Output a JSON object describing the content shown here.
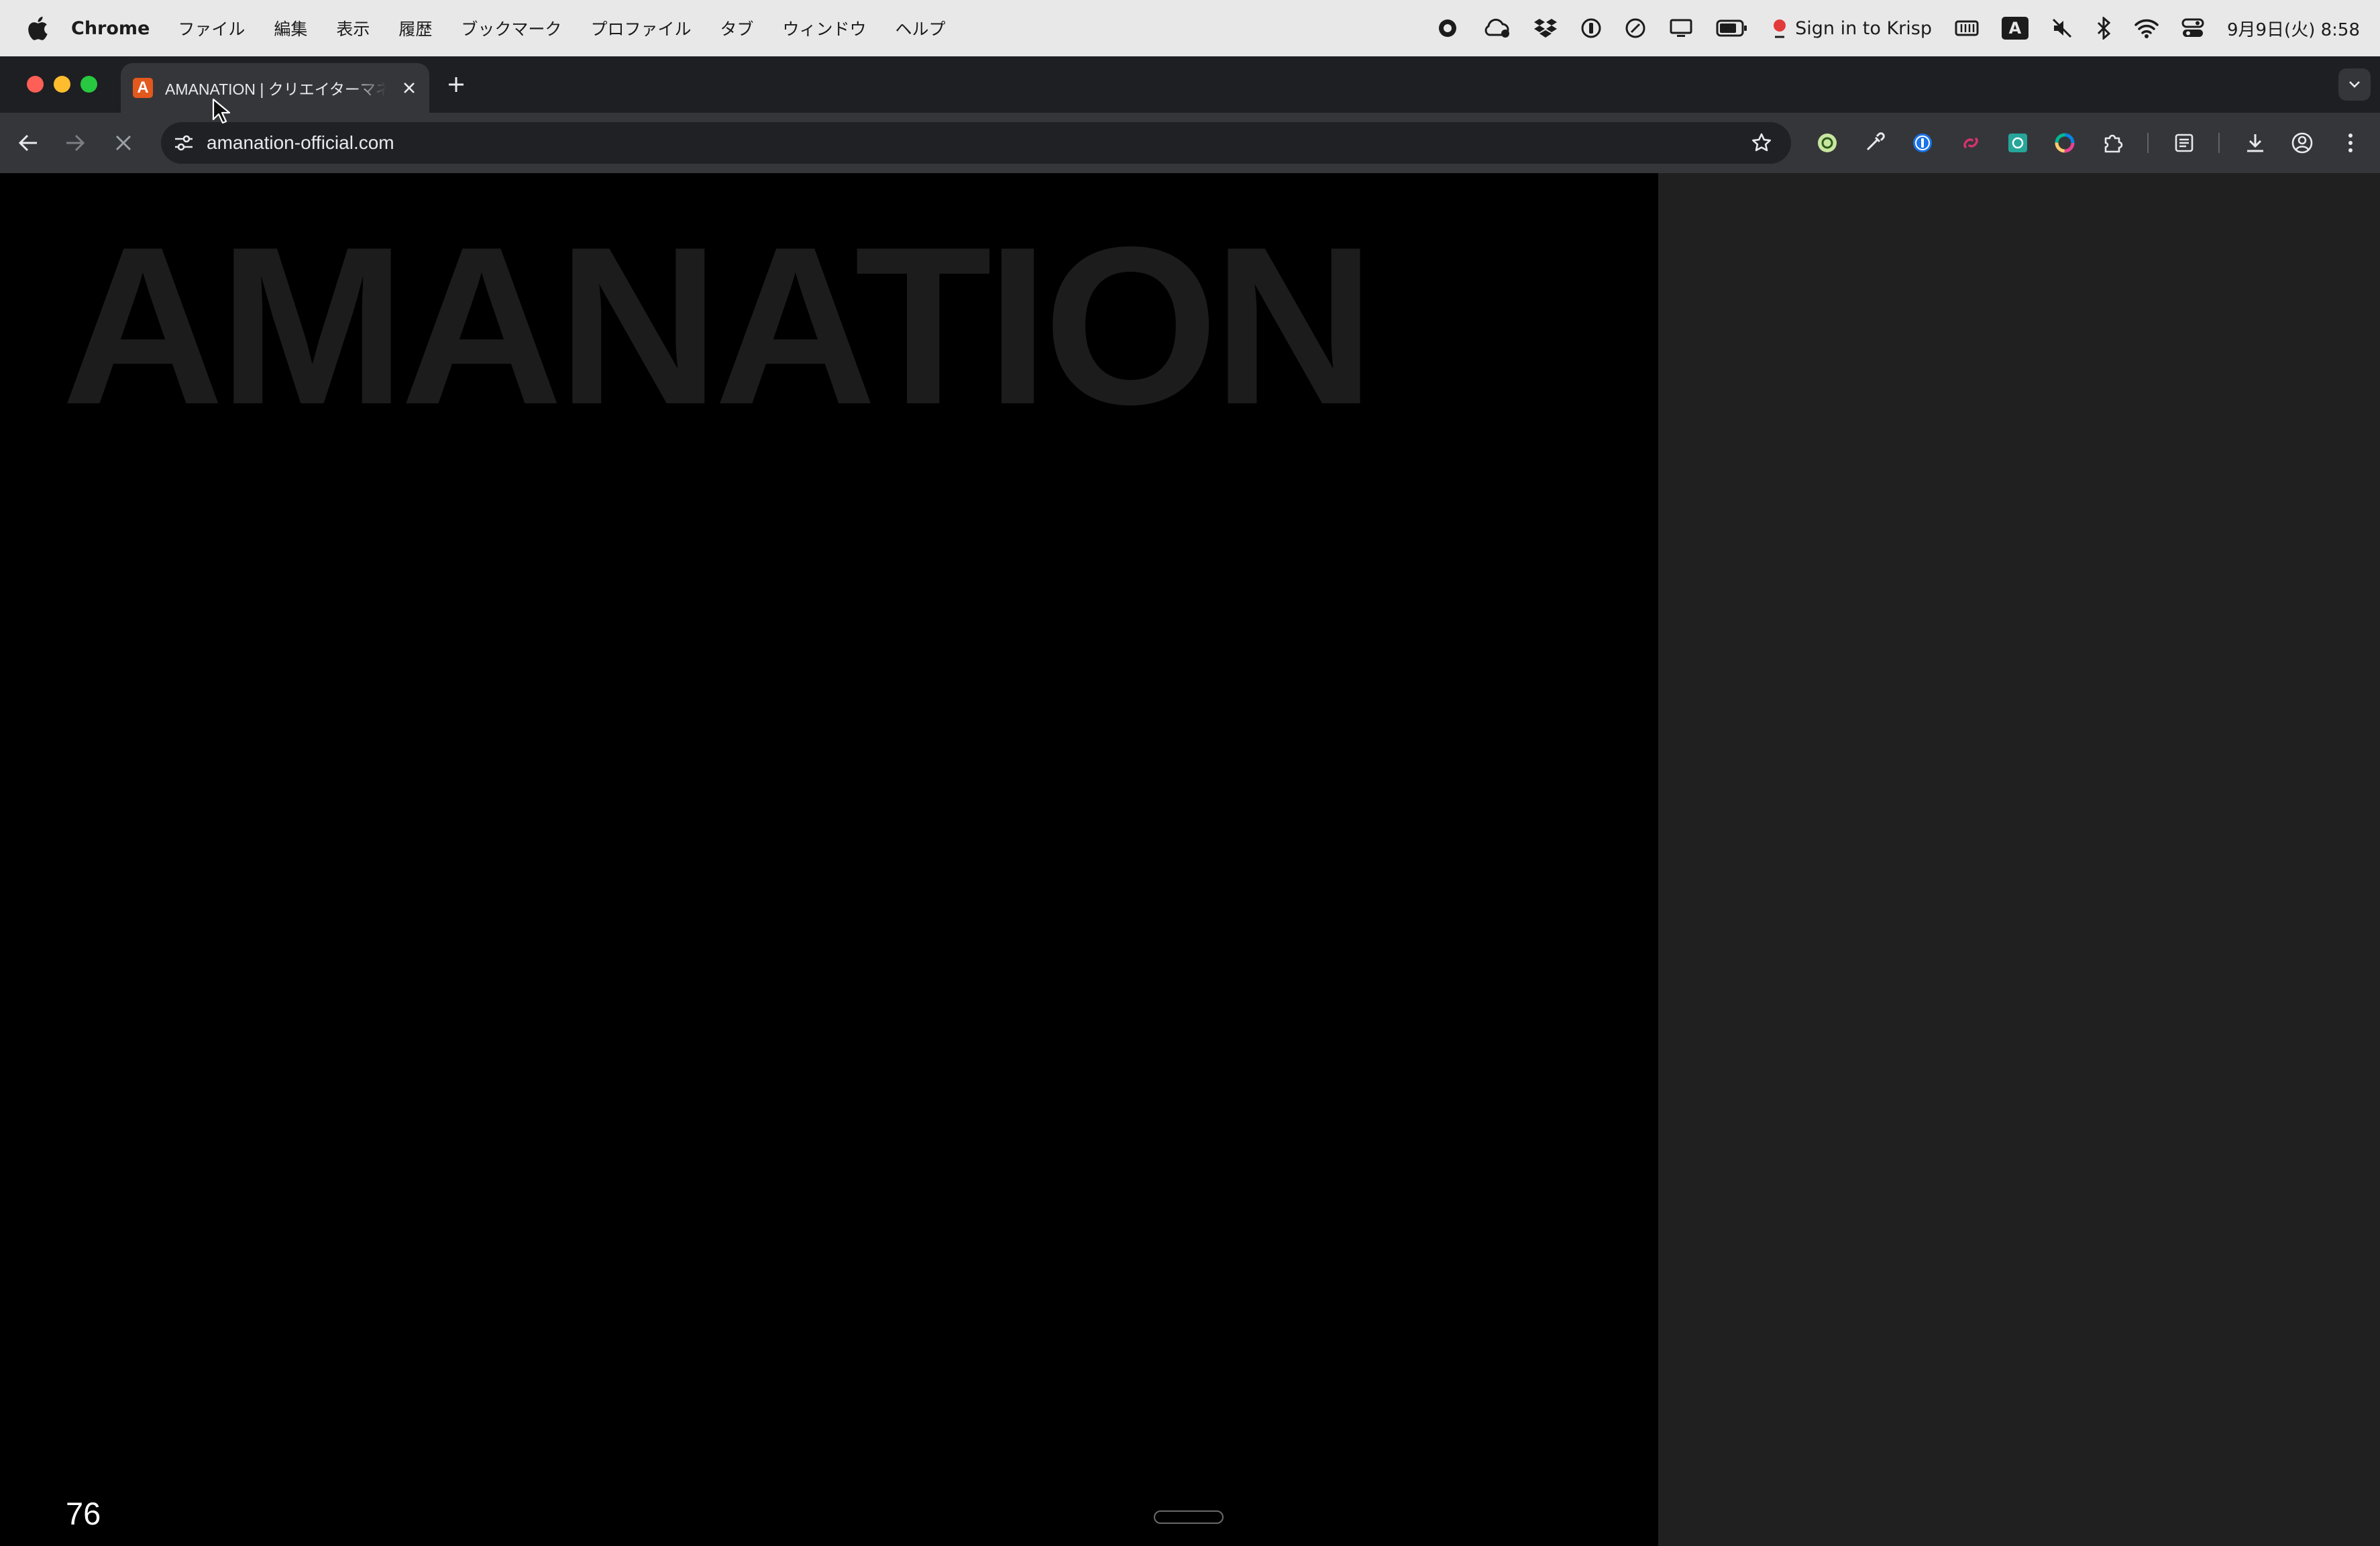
{
  "menubar": {
    "app_name": "Chrome",
    "items": [
      "ファイル",
      "編集",
      "表示",
      "履歴",
      "ブックマーク",
      "プロファイル",
      "タブ",
      "ウィンドウ",
      "ヘルプ"
    ],
    "status": {
      "krisp_label": "Sign in to Krisp",
      "input_source": "A",
      "clock": "9月9日(火) 8:58"
    }
  },
  "browser": {
    "tab": {
      "favicon_letter": "A",
      "title": "AMANATION | クリエイターマネジメント"
    },
    "url": "amanation-official.com"
  },
  "page": {
    "hero_title": "AMANATION",
    "counter": "76"
  },
  "colors": {
    "favicon": "#e2581d",
    "page_bg": "#000000",
    "hero_text": "#1c1c1c",
    "side_panel": "#202020"
  }
}
